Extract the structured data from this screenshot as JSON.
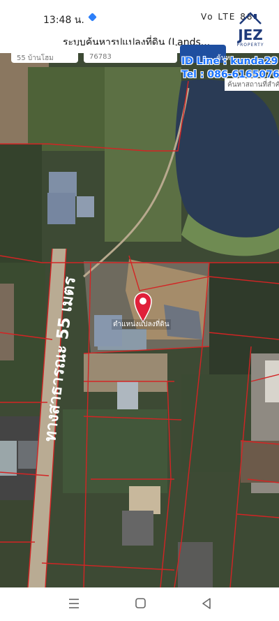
{
  "status": {
    "time": "13:48 น.",
    "battery": "88",
    "network": "Vo LTE"
  },
  "app": {
    "title": "ระบบค้นหารูปแปลงที่ดิน (Lands..."
  },
  "branding": {
    "logo_text": "JEZ",
    "logo_sub": "PROPERTY"
  },
  "search": {
    "field1": "55 บ้านโฮม",
    "field2": "76783",
    "button": "ค้นหา",
    "place_placeholder": "ค้นหาสถานที่สำคั"
  },
  "overlay": {
    "contact_line": "ID Line : kunda29",
    "contact_tel": "Tel : 086-6165076",
    "road_label": "ทางสาธารณะ 55 เมตร",
    "pin_label": "ตำแหน่งแปลงที่ดิน"
  },
  "colors": {
    "parcel_line": "#d32424",
    "pin": "#e0203a",
    "contact": "#1a73ff",
    "brand_blue": "#1e3a7a",
    "brand_red": "#d8232a"
  },
  "icons": {
    "back": "back-triangle-icon",
    "home": "home-square-icon",
    "recents": "recents-lines-icon",
    "pin": "location-pin-icon"
  }
}
